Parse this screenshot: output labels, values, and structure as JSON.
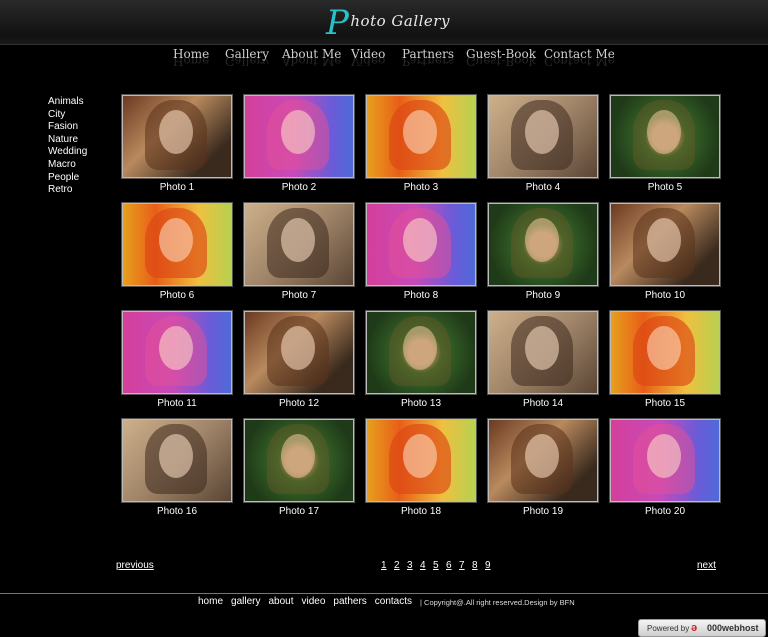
{
  "logo": {
    "initial": "P",
    "rest": "hoto Gallery"
  },
  "nav": [
    "Home",
    "Gallery",
    "About Me",
    "Video",
    "Partners",
    "Guest-Book",
    "Contact Me"
  ],
  "categories": [
    "Animals",
    "City",
    "Fasion",
    "Nature",
    "Wedding",
    "Macro",
    "People",
    "Retro"
  ],
  "photos": [
    {
      "caption": "Photo 1",
      "tone": "warm"
    },
    {
      "caption": "Photo 2",
      "tone": "pink"
    },
    {
      "caption": "Photo 3",
      "tone": "red"
    },
    {
      "caption": "Photo 4",
      "tone": "beige"
    },
    {
      "caption": "Photo 5",
      "tone": "green"
    },
    {
      "caption": "Photo 6",
      "tone": "red"
    },
    {
      "caption": "Photo 7",
      "tone": "beige"
    },
    {
      "caption": "Photo 8",
      "tone": "pink"
    },
    {
      "caption": "Photo 9",
      "tone": "green"
    },
    {
      "caption": "Photo 10",
      "tone": "warm"
    },
    {
      "caption": "Photo 11",
      "tone": "pink"
    },
    {
      "caption": "Photo 12",
      "tone": "warm"
    },
    {
      "caption": "Photo 13",
      "tone": "green"
    },
    {
      "caption": "Photo 14",
      "tone": "beige"
    },
    {
      "caption": "Photo 15",
      "tone": "red"
    },
    {
      "caption": "Photo 16",
      "tone": "beige"
    },
    {
      "caption": "Photo 17",
      "tone": "green"
    },
    {
      "caption": "Photo 18",
      "tone": "red"
    },
    {
      "caption": "Photo 19",
      "tone": "warm"
    },
    {
      "caption": "Photo 20",
      "tone": "pink"
    }
  ],
  "pager": {
    "previous": "previous",
    "next": "next",
    "pages": [
      "1",
      "2",
      "3",
      "4",
      "5",
      "6",
      "7",
      "8",
      "9"
    ]
  },
  "footer": {
    "links": [
      "home",
      "gallery",
      "about",
      "video",
      "pathers",
      "contacts"
    ],
    "copyright": "| Copyright@.All right reserved.Design by BFN"
  },
  "badge": {
    "powered": "Powered by",
    "brand": "000webhost",
    "icon": "webhost-logo-icon"
  },
  "colors": {
    "background": "#000000",
    "logo_accent": "#2ac0c8"
  }
}
